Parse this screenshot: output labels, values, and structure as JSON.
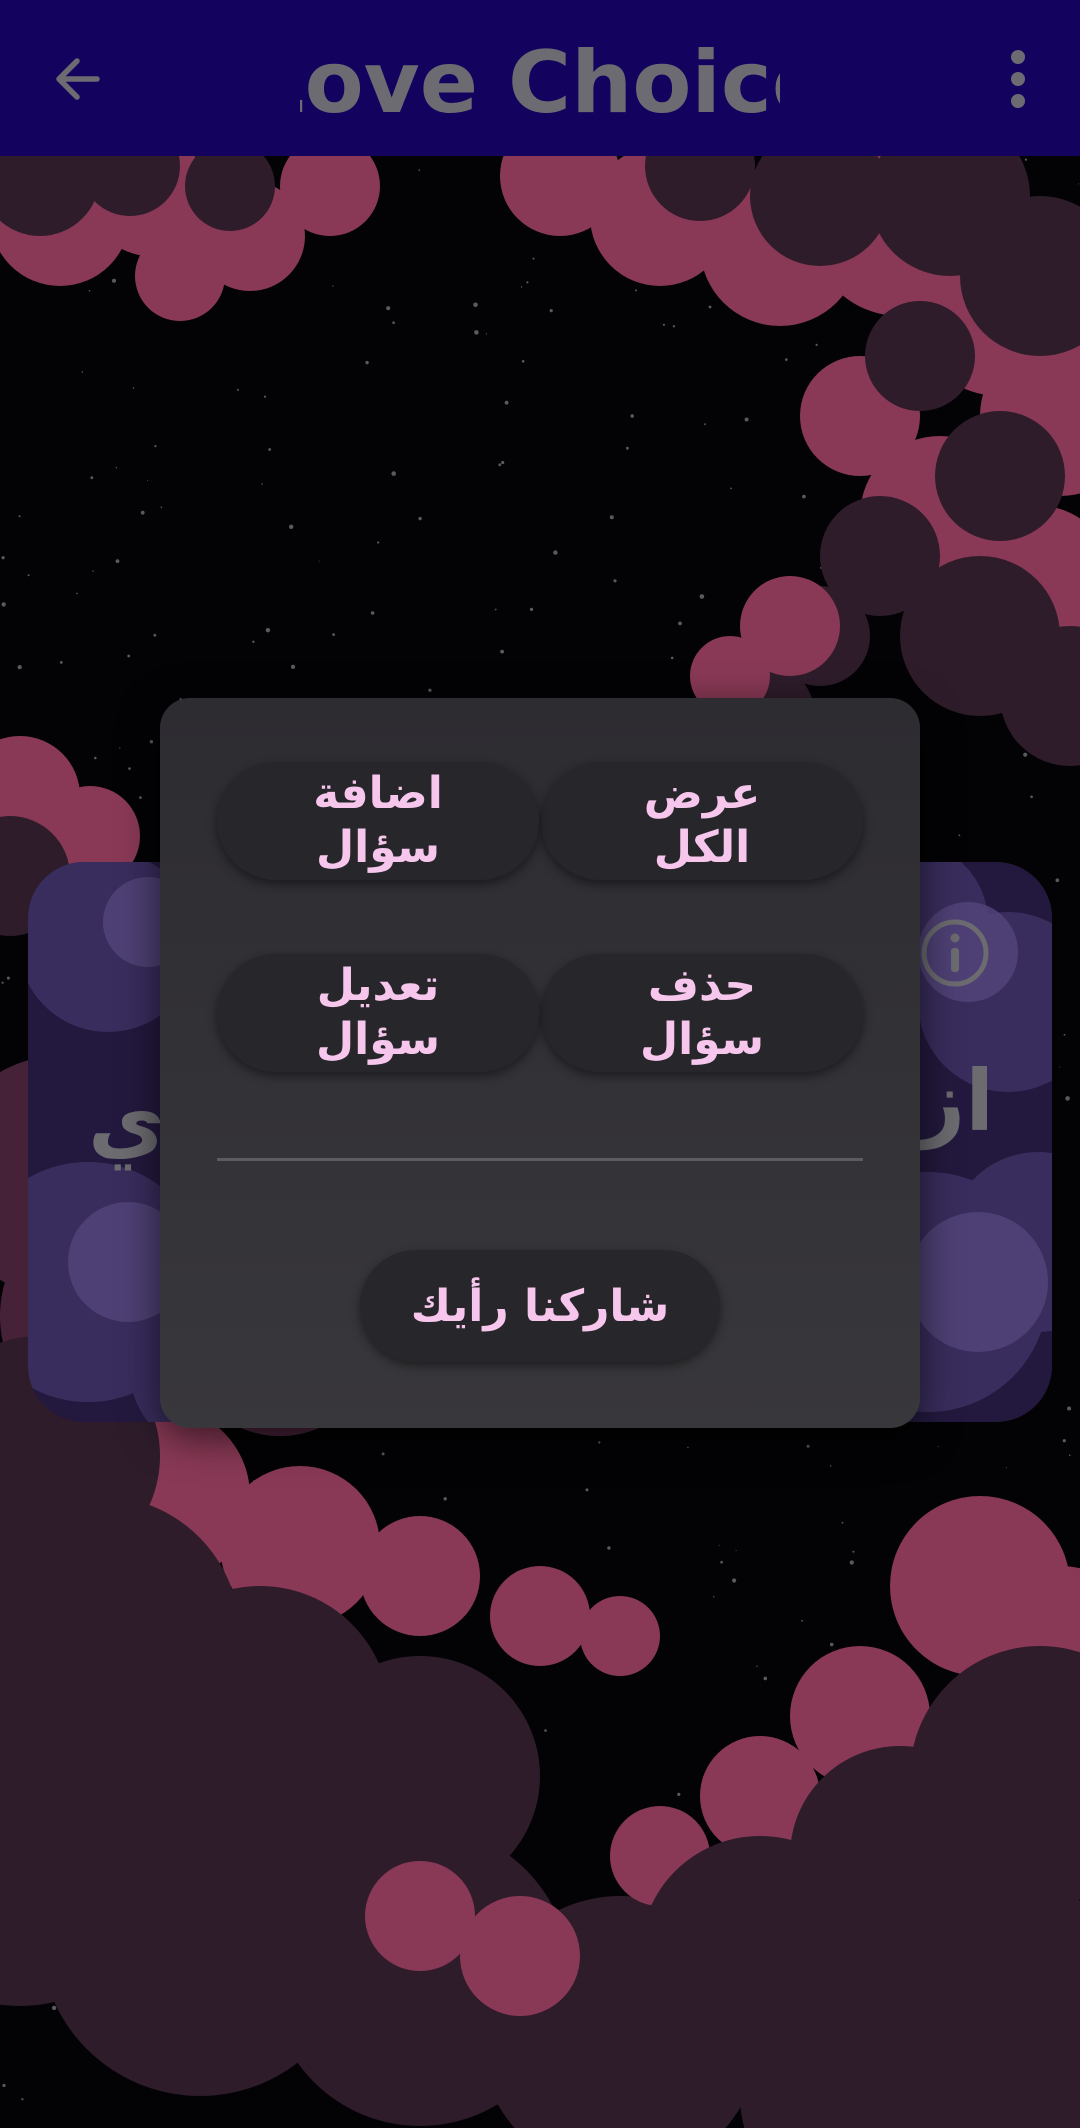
{
  "app": {
    "title": "Love Choice",
    "title_color": "#8c8a92",
    "bar_color": "#1a037a"
  },
  "toolbar": {
    "back_icon": "arrow-left-icon",
    "menu_icon": "more-vertical-icon"
  },
  "card": {
    "info_icon": "info-circle-icon",
    "text_right_visible": "ازا",
    "text_left_visible": "ي"
  },
  "dialog": {
    "buttons": [
      {
        "label": "عرض\nالكل"
      },
      {
        "label": "اضافة\nسؤال"
      },
      {
        "label": "حذف\nسؤال"
      },
      {
        "label": "تعديل\nسؤال"
      }
    ],
    "feedback_label": "شاركنا رأيك",
    "accent_text_color": "#f6c6ec"
  }
}
